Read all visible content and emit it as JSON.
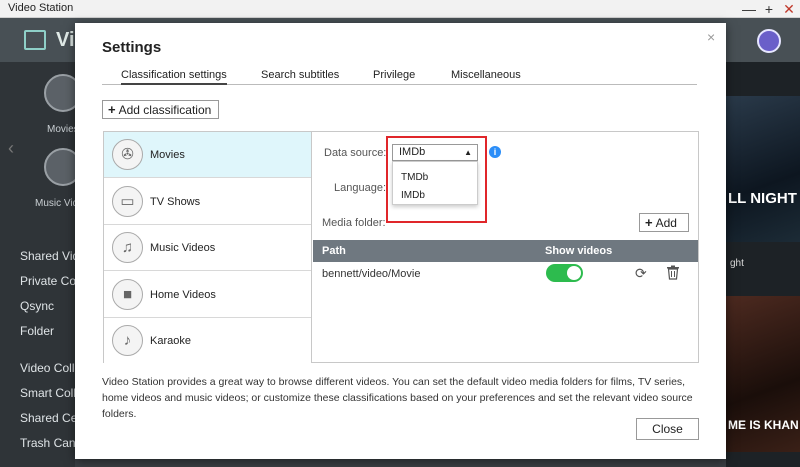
{
  "window": {
    "title": "Video Station",
    "controls": [
      "—",
      "+",
      "✕"
    ]
  },
  "background": {
    "brand": "Vid",
    "sidebar_labels": [
      "Movies",
      "Music Vid"
    ],
    "nav_items": [
      "Shared Vid",
      "Private Coll",
      "Qsync",
      "Folder",
      "Video Colle",
      "Smart Colle",
      "Shared Cen",
      "Trash Can"
    ],
    "poster_texts": [
      "LL NIGHT",
      "ght",
      "ME IS KHAN"
    ]
  },
  "modal": {
    "title": "Settings",
    "close_glyph": "×",
    "tabs": [
      {
        "label": "Classification settings",
        "active": true
      },
      {
        "label": "Search subtitles",
        "active": false
      },
      {
        "label": "Privilege",
        "active": false
      },
      {
        "label": "Miscellaneous",
        "active": false
      }
    ],
    "add_classification_label": "Add classification",
    "classifications": [
      {
        "label": "Movies",
        "icon": "film-reel-icon",
        "active": true
      },
      {
        "label": "TV Shows",
        "icon": "tv-icon",
        "active": false
      },
      {
        "label": "Music Videos",
        "icon": "music-video-icon",
        "active": false
      },
      {
        "label": "Home Videos",
        "icon": "camcorder-icon",
        "active": false
      },
      {
        "label": "Karaoke",
        "icon": "microphone-icon",
        "active": false
      }
    ],
    "details": {
      "data_source_label": "Data source:",
      "data_source_value": "IMDb",
      "data_source_options": [
        "TMDb",
        "IMDb"
      ],
      "language_label": "Language:",
      "media_folder_label": "Media folder:",
      "add_label": "Add",
      "table": {
        "headers": [
          "Path",
          "Show videos"
        ],
        "rows": [
          {
            "path": "bennett/video/Movie",
            "show_videos": true
          }
        ]
      }
    },
    "description": "Video Station provides a great way to browse different videos. You can set the default video media folders for films, TV series, home videos and music videos; or customize these classifications based on your preferences and set the relevant video source folders.",
    "close_label": "Close"
  },
  "colors": {
    "accent_active": "#dff6fb",
    "toggle_on": "#2dbb4e",
    "highlight": "#e0262a",
    "table_header": "#6f7880"
  }
}
